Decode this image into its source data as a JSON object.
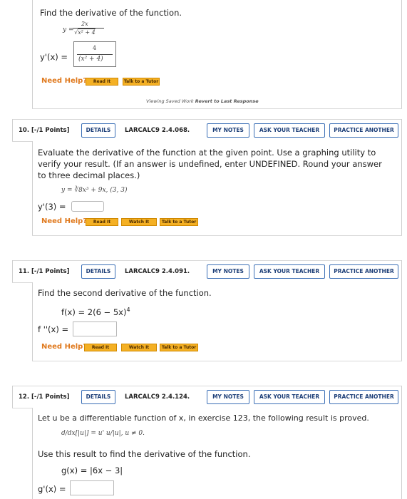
{
  "q9": {
    "prompt": "Find the derivative of the function.",
    "function_lhs": "y =",
    "function_num": "2x",
    "function_den": "x² + 4",
    "answer_label": "y'(x) =",
    "answer_num": "4",
    "answer_den": "(x² + 4)",
    "need_help": "Need Help?",
    "help_buttons": [
      "Read It",
      "Talk to a Tutor"
    ],
    "saved_text": "Viewing Saved Work",
    "revert_text": "Revert to Last Response"
  },
  "q10": {
    "number": "10.",
    "points": "[-/1 Points]",
    "details": "DETAILS",
    "code": "LARCALC9 2.4.068.",
    "my_notes": "MY NOTES",
    "ask_teacher": "ASK YOUR TEACHER",
    "practice": "PRACTICE ANOTHER",
    "prompt_lines": [
      "Evaluate the derivative of the function at the given point. Use a graphing utility to",
      "verify your result. (If an answer is undefined, enter UNDEFINED. Round your answer",
      "to three decimal places.)"
    ],
    "function_text": "y = ∛8x³ + 9x,   (3, 3)",
    "answer_label": "y'(3) =",
    "need_help": "Need Help?",
    "help_buttons": [
      "Read It",
      "Watch It",
      "Talk to a Tutor"
    ]
  },
  "q11": {
    "number": "11.",
    "points": "[-/1 Points]",
    "details": "DETAILS",
    "code": "LARCALC9 2.4.091.",
    "my_notes": "MY NOTES",
    "ask_teacher": "ASK YOUR TEACHER",
    "practice": "PRACTICE ANOTHER",
    "prompt": "Find the second derivative of the function.",
    "function_text": "f(x) = 2(6 − 5x)",
    "function_exp": "4",
    "answer_label": "f ''(x) =",
    "need_help": "Need Help?",
    "help_buttons": [
      "Read It",
      "Watch It",
      "Talk to a Tutor"
    ]
  },
  "q12": {
    "number": "12.",
    "points": "[-/1 Points]",
    "details": "DETAILS",
    "code": "LARCALC9 2.4.124.",
    "my_notes": "MY NOTES",
    "ask_teacher": "ASK YOUR TEACHER",
    "practice": "PRACTICE ANOTHER",
    "prompt": "Let u be a differentiable function of x, in exercise 123, the following result is proved.",
    "result_text": "d/dx[|u|] = u' u/|u|, u ≠ 0.",
    "prompt2": "Use this result to find the derivative of the function.",
    "function_text": "g(x) = |6x − 3|",
    "answer_label": "g'(x) ="
  }
}
